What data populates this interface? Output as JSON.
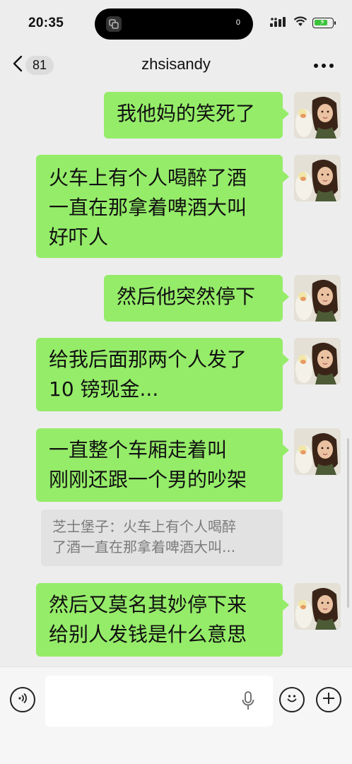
{
  "status": {
    "time": "20:35",
    "island_count": "0"
  },
  "nav": {
    "back_count": "81",
    "title": "zhsisandy"
  },
  "messages": [
    {
      "text": "我他妈的笑死了"
    },
    {
      "text": "火车上有个人喝醉了酒\n一直在那拿着啤酒大叫\n好吓人"
    },
    {
      "text": "然后他突然停下"
    },
    {
      "text": "给我后面那两个人发了\n10 镑现金..."
    },
    {
      "text": "一直整个车厢走着叫\n刚刚还跟一个男的吵架"
    },
    {
      "text": "然后又莫名其妙停下来\n给别人发钱是什么意思"
    }
  ],
  "quote": {
    "text": "芝士堡子：火车上有个人喝醉\n了酒一直在那拿着啤酒大叫..."
  },
  "input": {
    "value": ""
  },
  "colors": {
    "bubble": "#95ec69",
    "background": "#ededed"
  }
}
